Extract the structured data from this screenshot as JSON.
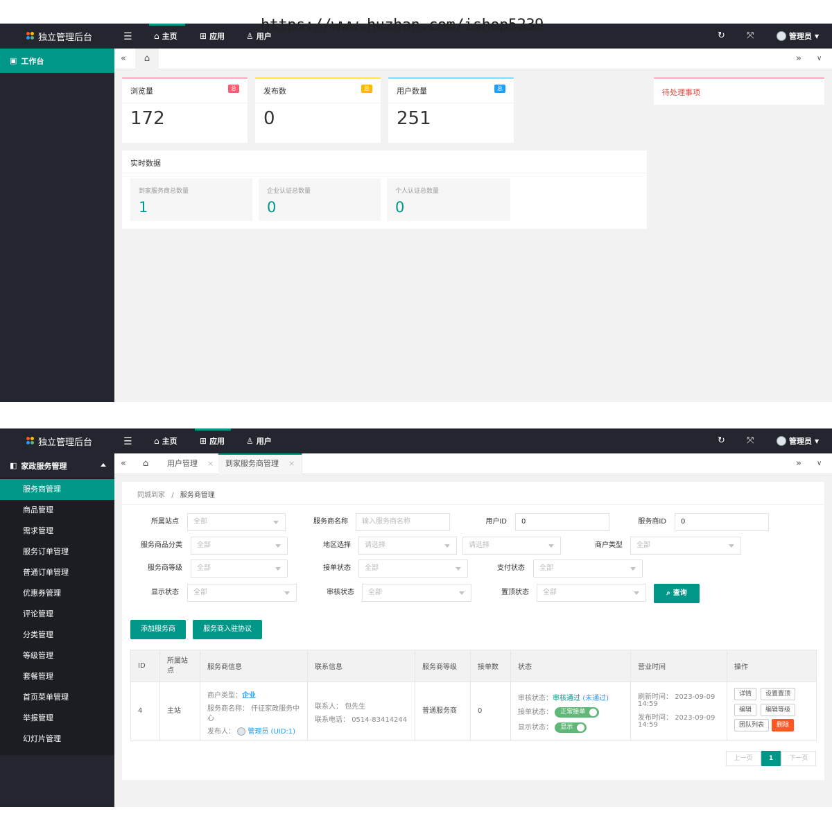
{
  "watermark": "https://www.huzhan.com/ishop5239",
  "app": {
    "title": "独立管理后台",
    "nav": {
      "home": "主页",
      "apps": "应用",
      "users": "用户"
    },
    "admin": "管理员",
    "colors": {
      "primary": "#009688",
      "sidebar": "#23262e",
      "topbar": "#23262e",
      "danger": "#ff5722"
    }
  },
  "dashboard": {
    "sidebar_item": "工作台",
    "stats": [
      {
        "title": "浏览量",
        "badge": "总",
        "value": "172",
        "badge_color": "#ff5a71"
      },
      {
        "title": "发布数",
        "badge": "总",
        "value": "0",
        "badge_color": "#ffb800"
      },
      {
        "title": "用户数量",
        "badge": "总",
        "value": "251",
        "badge_color": "#1e9fff"
      }
    ],
    "todo": "待处理事项",
    "realtime": {
      "title": "实时数据",
      "items": [
        {
          "label": "到家服务商总数量",
          "value": "1"
        },
        {
          "label": "企业认证总数量",
          "value": "0"
        },
        {
          "label": "个人认证总数量",
          "value": "0"
        }
      ]
    }
  },
  "manage": {
    "sidebar_group": "家政服务管理",
    "sidebar_items": [
      "服务商管理",
      "商品管理",
      "需求管理",
      "服务订单管理",
      "普通订单管理",
      "优惠券管理",
      "评论管理",
      "分类管理",
      "等级管理",
      "套餐管理",
      "首页菜单管理",
      "举报管理",
      "幻灯片管理"
    ],
    "tabs": {
      "user": "用户管理",
      "provider": "到家服务商管理"
    },
    "breadcrumb": {
      "root": "同城到家",
      "sep": "/",
      "current": "服务商管理"
    },
    "filters": {
      "station": {
        "label": "所属站点",
        "value": "全部"
      },
      "name": {
        "label": "服务商名称",
        "placeholder": "输入服务商名称"
      },
      "uid": {
        "label": "用户ID",
        "value": "0"
      },
      "pid": {
        "label": "服务商ID",
        "value": "0"
      },
      "category": {
        "label": "服务商品分类",
        "value": "全部"
      },
      "region": {
        "label": "地区选择",
        "value1": "请选择",
        "value2": "请选择"
      },
      "merchant_type": {
        "label": "商户类型",
        "value": "全部"
      },
      "level": {
        "label": "服务商等级",
        "value": "全部"
      },
      "accept": {
        "label": "接单状态",
        "value": "全部"
      },
      "pay": {
        "label": "支付状态",
        "value": "全部"
      },
      "display": {
        "label": "显示状态",
        "value": "全部"
      },
      "audit": {
        "label": "审核状态",
        "value": "全部"
      },
      "top": {
        "label": "置顶状态",
        "value": "全部"
      },
      "query": "查询"
    },
    "actions": {
      "add": "添加服务商",
      "agreement": "服务商入驻协议"
    },
    "table": {
      "headers": [
        "ID",
        "所属站点",
        "服务商信息",
        "联系信息",
        "服务商等级",
        "接单数",
        "状态",
        "营业时间",
        "操作"
      ],
      "row": {
        "id": "4",
        "station": "主站",
        "merchant_type_label": "商户类型：",
        "merchant_type": "企业",
        "name_label": "服务商名称：",
        "name_line1": "仟征家政服务中",
        "name_line2": "心",
        "publisher_label": "发布人：",
        "publisher": "管理员 (UID:1)",
        "contact_label": "联系人：",
        "contact": "包先生",
        "phone_label": "联系电话：",
        "phone": "0514-83414244",
        "level": "普通服务商",
        "orders": "0",
        "audit_label": "审核状态：",
        "audit_pass": "审核通过",
        "audit_fail": "(未通过)",
        "accept_label": "接单状态：",
        "accept_value": "正常接单",
        "display_label": "显示状态：",
        "display_value": "显示",
        "refresh_label": "刷新时间：",
        "refresh_date": "2023-09-09",
        "refresh_time": "14:59",
        "publish_label": "发布时间：",
        "publish_date": "2023-09-09",
        "publish_time": "14:59",
        "ops": {
          "detail": "详情",
          "set_top": "设置置顶",
          "edit": "编辑",
          "edit_level": "编辑等级",
          "team": "团队列表",
          "delete": "删除"
        }
      }
    },
    "pagination": {
      "prev": "上一页",
      "current": "1",
      "next": "下一页"
    }
  }
}
